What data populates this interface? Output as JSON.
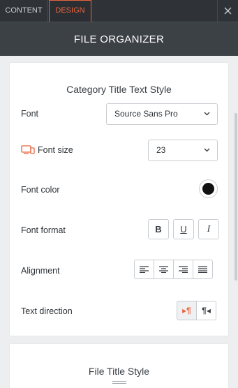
{
  "tabs": [
    {
      "label": "CONTENT",
      "active": false
    },
    {
      "label": "DESIGN",
      "active": true
    }
  ],
  "header": {
    "title": "FILE ORGANIZER"
  },
  "category_section": {
    "title": "Category Title Text Style",
    "font": {
      "label": "Font",
      "value": "Source Sans Pro"
    },
    "font_size": {
      "label": "Font size",
      "value": "23"
    },
    "font_color": {
      "label": "Font color",
      "value": "#111111"
    },
    "font_format": {
      "label": "Font format",
      "bold": "B",
      "underline": "U",
      "italic": "I"
    },
    "alignment": {
      "label": "Alignment"
    },
    "text_direction": {
      "label": "Text direction",
      "ltr": "¶",
      "rtl": "¶"
    }
  },
  "file_section": {
    "title": "File Title Style"
  },
  "colors": {
    "accent": "#e8643f",
    "tabbar": "#2f3337",
    "header": "#3c4146"
  }
}
